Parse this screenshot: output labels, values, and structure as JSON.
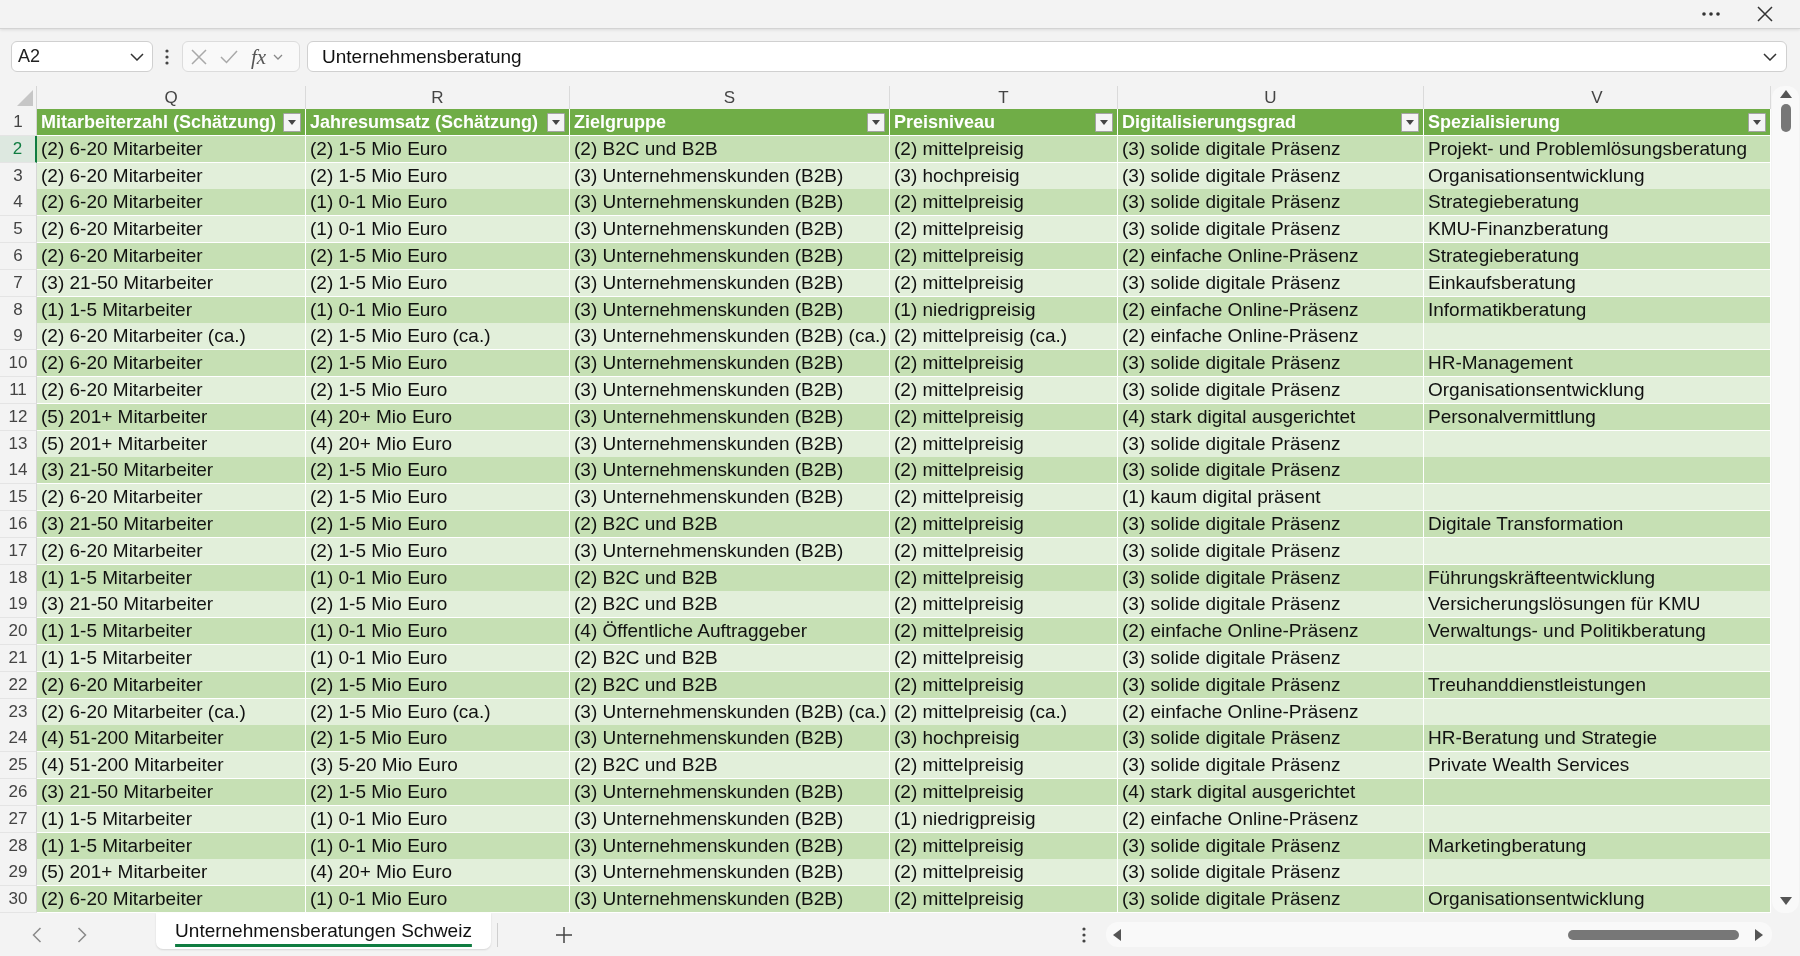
{
  "formula_bar": {
    "name_box": "A2",
    "function_button": "fx",
    "formula": "Unternehmensberatung"
  },
  "columns": [
    {
      "letter": "Q",
      "header": "Mitarbeiterzahl (Schätzung)"
    },
    {
      "letter": "R",
      "header": "Jahresumsatz (Schätzung)"
    },
    {
      "letter": "S",
      "header": "Zielgruppe"
    },
    {
      "letter": "T",
      "header": "Preisniveau"
    },
    {
      "letter": "U",
      "header": "Digitalisierungsgrad"
    },
    {
      "letter": "V",
      "header": "Spezialisierung"
    }
  ],
  "header_row_number": "1",
  "rows": [
    {
      "number": "2",
      "selected": true,
      "mitarbeiterzahl": "(2) 6-20 Mitarbeiter",
      "jahresumsatz": "(2) 1-5 Mio Euro",
      "zielgruppe": "(2) B2C und B2B",
      "preisniveau": "(2) mittelpreisig",
      "digitalisierungsgrad": "(3) solide digitale Präsenz",
      "spezialisierung": "Projekt- und Problemlösungsberatung"
    },
    {
      "number": "3",
      "selected": false,
      "mitarbeiterzahl": "(2) 6-20 Mitarbeiter",
      "jahresumsatz": "(2) 1-5 Mio Euro",
      "zielgruppe": "(3) Unternehmenskunden (B2B)",
      "preisniveau": "(3) hochpreisig",
      "digitalisierungsgrad": "(3) solide digitale Präsenz",
      "spezialisierung": "Organisationsentwicklung"
    },
    {
      "number": "4",
      "selected": false,
      "mitarbeiterzahl": "(2) 6-20 Mitarbeiter",
      "jahresumsatz": "(1) 0-1 Mio Euro",
      "zielgruppe": "(3) Unternehmenskunden (B2B)",
      "preisniveau": "(2) mittelpreisig",
      "digitalisierungsgrad": "(3) solide digitale Präsenz",
      "spezialisierung": "Strategieberatung"
    },
    {
      "number": "5",
      "selected": false,
      "mitarbeiterzahl": "(2) 6-20 Mitarbeiter",
      "jahresumsatz": "(1) 0-1 Mio Euro",
      "zielgruppe": "(3) Unternehmenskunden (B2B)",
      "preisniveau": "(2) mittelpreisig",
      "digitalisierungsgrad": "(3) solide digitale Präsenz",
      "spezialisierung": "KMU-Finanzberatung"
    },
    {
      "number": "6",
      "selected": false,
      "mitarbeiterzahl": "(2) 6-20 Mitarbeiter",
      "jahresumsatz": "(2) 1-5 Mio Euro",
      "zielgruppe": "(3) Unternehmenskunden (B2B)",
      "preisniveau": "(2) mittelpreisig",
      "digitalisierungsgrad": "(2) einfache Online-Präsenz",
      "spezialisierung": "Strategieberatung"
    },
    {
      "number": "7",
      "selected": false,
      "mitarbeiterzahl": "(3) 21-50 Mitarbeiter",
      "jahresumsatz": "(2) 1-5 Mio Euro",
      "zielgruppe": "(3) Unternehmenskunden (B2B)",
      "preisniveau": "(2) mittelpreisig",
      "digitalisierungsgrad": "(3) solide digitale Präsenz",
      "spezialisierung": "Einkaufsberatung"
    },
    {
      "number": "8",
      "selected": false,
      "mitarbeiterzahl": "(1) 1-5 Mitarbeiter",
      "jahresumsatz": "(1) 0-1 Mio Euro",
      "zielgruppe": "(3) Unternehmenskunden (B2B)",
      "preisniveau": "(1) niedrigpreisig",
      "digitalisierungsgrad": "(2) einfache Online-Präsenz",
      "spezialisierung": "Informatikberatung"
    },
    {
      "number": "9",
      "selected": false,
      "mitarbeiterzahl": "(2) 6-20 Mitarbeiter (ca.)",
      "jahresumsatz": "(2) 1-5 Mio Euro (ca.)",
      "zielgruppe": "(3) Unternehmenskunden (B2B) (ca.)",
      "preisniveau": "(2) mittelpreisig (ca.)",
      "digitalisierungsgrad": "(2) einfache Online-Präsenz"
    },
    {
      "number": "10",
      "selected": false,
      "mitarbeiterzahl": "(2) 6-20 Mitarbeiter",
      "jahresumsatz": "(2) 1-5 Mio Euro",
      "zielgruppe": "(3) Unternehmenskunden (B2B)",
      "preisniveau": "(2) mittelpreisig",
      "digitalisierungsgrad": "(3) solide digitale Präsenz",
      "spezialisierung": "HR-Management"
    },
    {
      "number": "11",
      "selected": false,
      "mitarbeiterzahl": "(2) 6-20 Mitarbeiter",
      "jahresumsatz": "(2) 1-5 Mio Euro",
      "zielgruppe": "(3) Unternehmenskunden (B2B)",
      "preisniveau": "(2) mittelpreisig",
      "digitalisierungsgrad": "(3) solide digitale Präsenz",
      "spezialisierung": "Organisationsentwicklung"
    },
    {
      "number": "12",
      "selected": false,
      "mitarbeiterzahl": "(5) 201+ Mitarbeiter",
      "jahresumsatz": "(4) 20+ Mio Euro",
      "zielgruppe": "(3) Unternehmenskunden (B2B)",
      "preisniveau": "(2) mittelpreisig",
      "digitalisierungsgrad": "(4) stark digital ausgerichtet",
      "spezialisierung": "Personalvermittlung"
    },
    {
      "number": "13",
      "selected": false,
      "mitarbeiterzahl": "(5) 201+ Mitarbeiter",
      "jahresumsatz": "(4) 20+ Mio Euro",
      "zielgruppe": "(3) Unternehmenskunden (B2B)",
      "preisniveau": "(2) mittelpreisig",
      "digitalisierungsgrad": "(3) solide digitale Präsenz"
    },
    {
      "number": "14",
      "selected": false,
      "mitarbeiterzahl": "(3) 21-50 Mitarbeiter",
      "jahresumsatz": "(2) 1-5 Mio Euro",
      "zielgruppe": "(3) Unternehmenskunden (B2B)",
      "preisniveau": "(2) mittelpreisig",
      "digitalisierungsgrad": "(3) solide digitale Präsenz"
    },
    {
      "number": "15",
      "selected": false,
      "mitarbeiterzahl": "(2) 6-20 Mitarbeiter",
      "jahresumsatz": "(2) 1-5 Mio Euro",
      "zielgruppe": "(3) Unternehmenskunden (B2B)",
      "preisniveau": "(2) mittelpreisig",
      "digitalisierungsgrad": "(1) kaum digital präsent"
    },
    {
      "number": "16",
      "selected": false,
      "mitarbeiterzahl": "(3) 21-50 Mitarbeiter",
      "jahresumsatz": "(2) 1-5 Mio Euro",
      "zielgruppe": "(2) B2C und B2B",
      "preisniveau": "(2) mittelpreisig",
      "digitalisierungsgrad": "(3) solide digitale Präsenz",
      "spezialisierung": "Digitale Transformation"
    },
    {
      "number": "17",
      "selected": false,
      "mitarbeiterzahl": "(2) 6-20 Mitarbeiter",
      "jahresumsatz": "(2) 1-5 Mio Euro",
      "zielgruppe": "(3) Unternehmenskunden (B2B)",
      "preisniveau": "(2) mittelpreisig",
      "digitalisierungsgrad": "(3) solide digitale Präsenz"
    },
    {
      "number": "18",
      "selected": false,
      "mitarbeiterzahl": "(1) 1-5 Mitarbeiter",
      "jahresumsatz": "(1) 0-1 Mio Euro",
      "zielgruppe": "(2) B2C und B2B",
      "preisniveau": "(2) mittelpreisig",
      "digitalisierungsgrad": "(3) solide digitale Präsenz",
      "spezialisierung": "Führungskräfteentwicklung"
    },
    {
      "number": "19",
      "selected": false,
      "mitarbeiterzahl": "(3) 21-50 Mitarbeiter",
      "jahresumsatz": "(2) 1-5 Mio Euro",
      "zielgruppe": "(2) B2C und B2B",
      "preisniveau": "(2) mittelpreisig",
      "digitalisierungsgrad": "(3) solide digitale Präsenz",
      "spezialisierung": "Versicherungslösungen für KMU"
    },
    {
      "number": "20",
      "selected": false,
      "mitarbeiterzahl": "(1) 1-5 Mitarbeiter",
      "jahresumsatz": "(1) 0-1 Mio Euro",
      "zielgruppe": "(4) Öffentliche Auftraggeber",
      "preisniveau": "(2) mittelpreisig",
      "digitalisierungsgrad": "(2) einfache Online-Präsenz",
      "spezialisierung": "Verwaltungs- und Politikberatung"
    },
    {
      "number": "21",
      "selected": false,
      "mitarbeiterzahl": "(1) 1-5 Mitarbeiter",
      "jahresumsatz": "(1) 0-1 Mio Euro",
      "zielgruppe": "(2) B2C und B2B",
      "preisniveau": "(2) mittelpreisig",
      "digitalisierungsgrad": "(3) solide digitale Präsenz"
    },
    {
      "number": "22",
      "selected": false,
      "mitarbeiterzahl": "(2) 6-20 Mitarbeiter",
      "jahresumsatz": "(2) 1-5 Mio Euro",
      "zielgruppe": "(2) B2C und B2B",
      "preisniveau": "(2) mittelpreisig",
      "digitalisierungsgrad": "(3) solide digitale Präsenz",
      "spezialisierung": "Treuhanddienstleistungen"
    },
    {
      "number": "23",
      "selected": false,
      "mitarbeiterzahl": "(2) 6-20 Mitarbeiter (ca.)",
      "jahresumsatz": "(2) 1-5 Mio Euro (ca.)",
      "zielgruppe": "(3) Unternehmenskunden (B2B) (ca.)",
      "preisniveau": "(2) mittelpreisig (ca.)",
      "digitalisierungsgrad": "(2) einfache Online-Präsenz"
    },
    {
      "number": "24",
      "selected": false,
      "mitarbeiterzahl": "(4) 51-200 Mitarbeiter",
      "jahresumsatz": "(2) 1-5 Mio Euro",
      "zielgruppe": "(3) Unternehmenskunden (B2B)",
      "preisniveau": "(3) hochpreisig",
      "digitalisierungsgrad": "(3) solide digitale Präsenz",
      "spezialisierung": "HR-Beratung und Strategie"
    },
    {
      "number": "25",
      "selected": false,
      "mitarbeiterzahl": "(4) 51-200 Mitarbeiter",
      "jahresumsatz": "(3) 5-20 Mio Euro",
      "zielgruppe": "(2) B2C und B2B",
      "preisniveau": "(2) mittelpreisig",
      "digitalisierungsgrad": "(3) solide digitale Präsenz",
      "spezialisierung": "Private Wealth Services"
    },
    {
      "number": "26",
      "selected": false,
      "mitarbeiterzahl": "(3) 21-50 Mitarbeiter",
      "jahresumsatz": "(2) 1-5 Mio Euro",
      "zielgruppe": "(3) Unternehmenskunden (B2B)",
      "preisniveau": "(2) mittelpreisig",
      "digitalisierungsgrad": "(4) stark digital ausgerichtet"
    },
    {
      "number": "27",
      "selected": false,
      "mitarbeiterzahl": "(1) 1-5 Mitarbeiter",
      "jahresumsatz": "(1) 0-1 Mio Euro",
      "zielgruppe": "(3) Unternehmenskunden (B2B)",
      "preisniveau": "(1) niedrigpreisig",
      "digitalisierungsgrad": "(2) einfache Online-Präsenz"
    },
    {
      "number": "28",
      "selected": false,
      "mitarbeiterzahl": "(1) 1-5 Mitarbeiter",
      "jahresumsatz": "(1) 0-1 Mio Euro",
      "zielgruppe": "(3) Unternehmenskunden (B2B)",
      "preisniveau": "(2) mittelpreisig",
      "digitalisierungsgrad": "(3) solide digitale Präsenz",
      "spezialisierung": "Marketingberatung"
    },
    {
      "number": "29",
      "selected": false,
      "mitarbeiterzahl": "(5) 201+ Mitarbeiter",
      "jahresumsatz": "(4) 20+ Mio Euro",
      "zielgruppe": "(3) Unternehmenskunden (B2B)",
      "preisniveau": "(2) mittelpreisig",
      "digitalisierungsgrad": "(3) solide digitale Präsenz"
    },
    {
      "number": "30",
      "selected": false,
      "mitarbeiterzahl": "(2) 6-20 Mitarbeiter",
      "jahresumsatz": "(1) 0-1 Mio Euro",
      "zielgruppe": "(3) Unternehmenskunden (B2B)",
      "preisniveau": "(2) mittelpreisig",
      "digitalisierungsgrad": "(3) solide digitale Präsenz",
      "spezialisierung": "Organisationsentwicklung"
    }
  ],
  "sheet_tabs": [
    {
      "label": "Unternehmensberatungen Schweiz",
      "selected": true
    }
  ]
}
